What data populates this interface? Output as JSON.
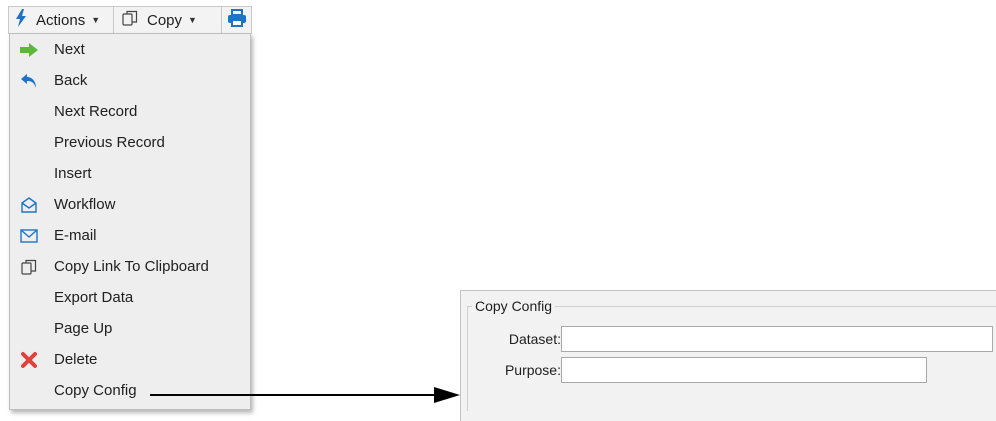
{
  "toolbar": {
    "actions_label": "Actions",
    "copy_label": "Copy",
    "actions_icon": "lightning-icon",
    "copy_icon": "copy-icon",
    "print_icon": "printer-icon"
  },
  "menu": {
    "items": [
      {
        "label": "Next",
        "icon": "arrow-right-icon"
      },
      {
        "label": "Back",
        "icon": "undo-arrow-icon"
      },
      {
        "label": "Next Record",
        "icon": ""
      },
      {
        "label": "Previous Record",
        "icon": ""
      },
      {
        "label": "Insert",
        "icon": ""
      },
      {
        "label": "Workflow",
        "icon": "workflow-envelope-icon"
      },
      {
        "label": "E-mail",
        "icon": "mail-icon"
      },
      {
        "label": "Copy Link To Clipboard",
        "icon": "copy-icon"
      },
      {
        "label": "Export Data",
        "icon": ""
      },
      {
        "label": "Page Up",
        "icon": ""
      },
      {
        "label": "Delete",
        "icon": "delete-x-icon"
      },
      {
        "label": "Copy Config",
        "icon": ""
      }
    ]
  },
  "copy_config": {
    "title": "Copy Config",
    "dataset_label": "Dataset:",
    "dataset_value": "",
    "purpose_label": "Purpose:",
    "purpose_value": ""
  },
  "colors": {
    "accent_blue": "#1e73c8",
    "next_green": "#5cb83c",
    "delete_red": "#e0413a"
  }
}
